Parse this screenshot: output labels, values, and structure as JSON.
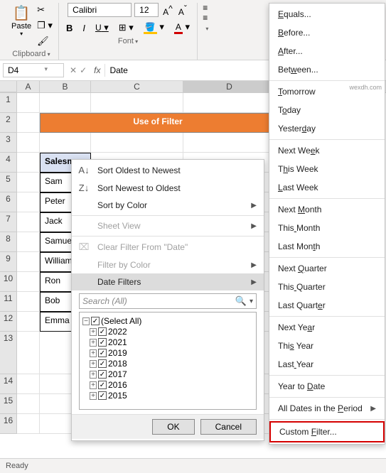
{
  "ribbon": {
    "paste": "Paste",
    "clipboard_group": "Clipboard",
    "font_group": "Font",
    "font_name": "Calibri",
    "font_size": "12",
    "grow": "A^",
    "shrink": "A˅",
    "bold": "B",
    "italic": "I",
    "underline": "U"
  },
  "formula_bar": {
    "name_box": "D4",
    "value": "Date"
  },
  "columns": [
    "A",
    "B",
    "C",
    "D"
  ],
  "rows": [
    "1",
    "2",
    "3",
    "4",
    "5",
    "6",
    "7",
    "8",
    "9",
    "10",
    "11",
    "12",
    "13",
    "14",
    "15",
    "16"
  ],
  "title": "Use of Filter",
  "header": {
    "salesman": "Salesman"
  },
  "salesmen": [
    "Sam",
    "Peter",
    "Jack",
    "Samuel",
    "William",
    "Ron",
    "Bob",
    "Emma"
  ],
  "context_menu": {
    "sort_asc": "Sort Oldest to Newest",
    "sort_desc": "Sort Newest to Oldest",
    "sort_color": "Sort by Color",
    "sheet_view": "Sheet View",
    "clear_filter": "Clear Filter From \"Date\"",
    "filter_color": "Filter by Color",
    "date_filters": "Date Filters",
    "search_placeholder": "Search (All)",
    "select_all": "(Select All)",
    "years": [
      "2022",
      "2021",
      "2019",
      "2018",
      "2017",
      "2016",
      "2015"
    ],
    "ok": "OK",
    "cancel": "Cancel"
  },
  "submenu": {
    "items": [
      {
        "label": "Equals...",
        "u": 0
      },
      {
        "label": "Before...",
        "u": 0
      },
      {
        "label": "After...",
        "u": 0
      },
      {
        "label": "Between...",
        "u": 3
      },
      {
        "sep": true
      },
      {
        "label": "Tomorrow",
        "u": 0
      },
      {
        "label": "Today",
        "u": 1
      },
      {
        "label": "Yesterday",
        "u": 6
      },
      {
        "sep": true
      },
      {
        "label": "Next Week",
        "u": 7
      },
      {
        "label": "This Week",
        "u": 1
      },
      {
        "label": "Last Week",
        "u": 0
      },
      {
        "sep": true
      },
      {
        "label": "Next Month",
        "u": 5
      },
      {
        "label": "This Month",
        "u": 4
      },
      {
        "label": "Last Month",
        "u": 8
      },
      {
        "sep": true
      },
      {
        "label": "Next Quarter",
        "u": 5
      },
      {
        "label": "This Quarter",
        "u": 4
      },
      {
        "label": "Last Quarter",
        "u": 10
      },
      {
        "sep": true
      },
      {
        "label": "Next Year",
        "u": 7
      },
      {
        "label": "This Year",
        "u": 3
      },
      {
        "label": "Last Year",
        "u": 4
      },
      {
        "sep": true
      },
      {
        "label": "Year to Date",
        "u": 8
      },
      {
        "sep": true
      },
      {
        "label": "All Dates in the Period",
        "u": 17,
        "arrow": true
      },
      {
        "sep": true
      },
      {
        "label": "Custom Filter...",
        "u": 7,
        "custom": true
      }
    ]
  },
  "status": "Ready",
  "watermark": "wexdh.com"
}
